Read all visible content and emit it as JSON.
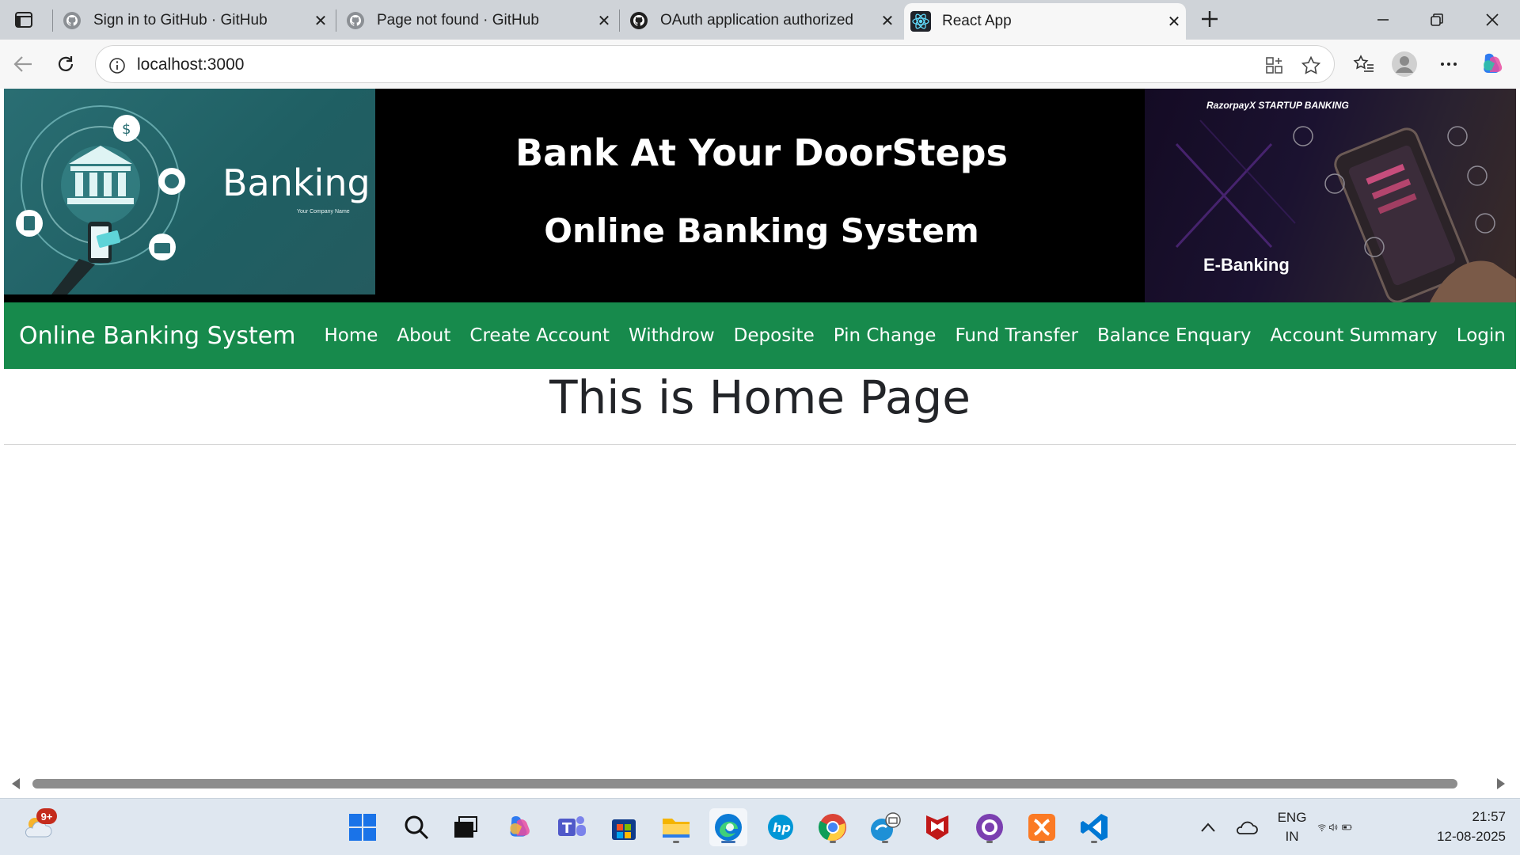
{
  "browser": {
    "tabs": [
      {
        "title": "Sign in to GitHub · GitHub",
        "icon": "github-icon",
        "active": false
      },
      {
        "title": "Page not found · GitHub",
        "icon": "github-icon",
        "active": false
      },
      {
        "title": "OAuth application authorized",
        "icon": "github-icon",
        "active": false
      },
      {
        "title": "React App",
        "icon": "react-icon",
        "active": true
      }
    ],
    "url": "localhost:3000"
  },
  "page": {
    "banner": {
      "left_word": "Banking",
      "left_company": "Your Company Name",
      "title": "Bank At Your DoorSteps",
      "subtitle": "Online Banking System",
      "right_brand": "RazorpayX STARTUP BANKING",
      "right_label": "E-Banking"
    },
    "navbar": {
      "brand": "Online Banking System",
      "links": [
        "Home",
        "About",
        "Create Account",
        "Withdrow",
        "Deposite",
        "Pin Change",
        "Fund Transfer",
        "Balance Enquary",
        "Account Summary",
        "Login"
      ],
      "color": "#178a4c"
    },
    "heading": "This is Home Page"
  },
  "taskbar": {
    "weather_badge": "9+",
    "apps": [
      "start-icon",
      "search-icon",
      "task-view-icon",
      "copilot-icon",
      "teams-icon",
      "store-icon",
      "file-explorer-icon",
      "edge-icon",
      "hp-icon",
      "chrome-icon",
      "mail-icon",
      "mcafee-icon",
      "github-desktop-icon",
      "xampp-icon",
      "vscode-icon"
    ],
    "language": "ENG",
    "region": "IN",
    "time": "21:57",
    "date": "12-08-2025"
  }
}
